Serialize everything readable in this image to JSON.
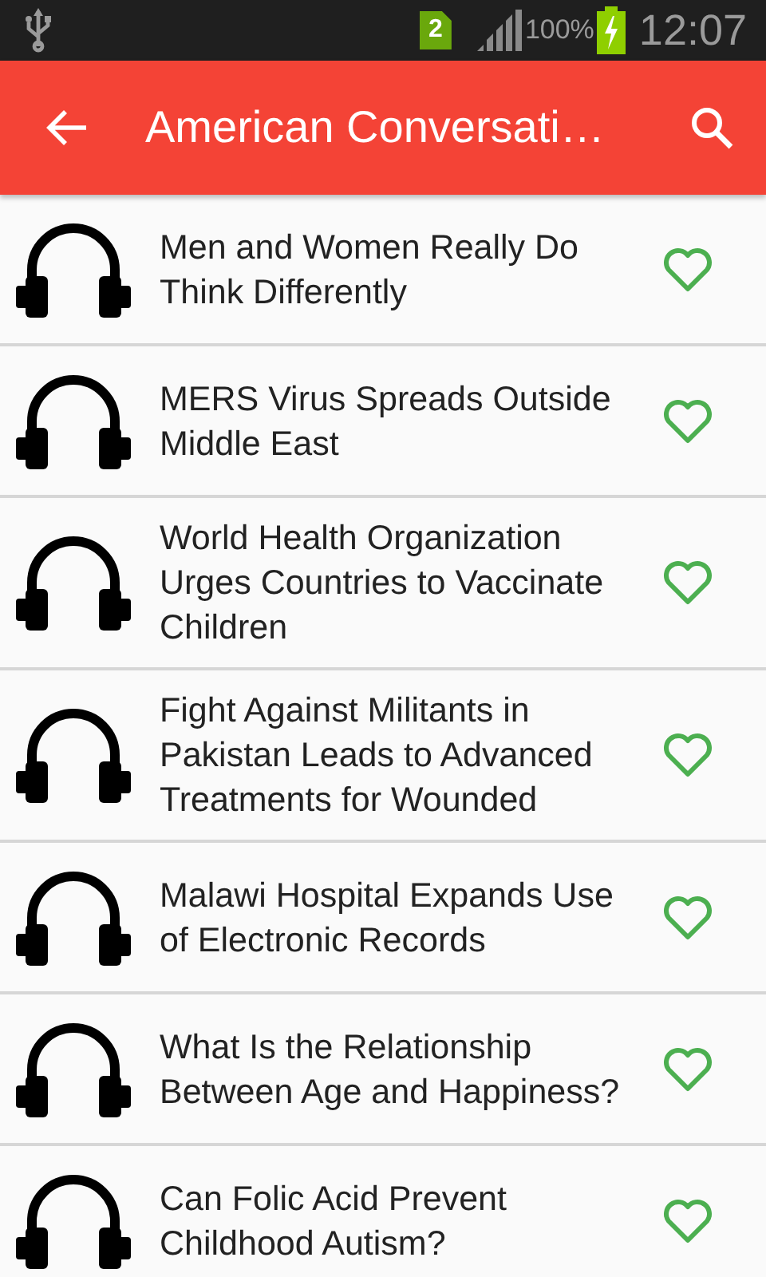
{
  "status_bar": {
    "sim_label": "2",
    "battery": "100%",
    "time": "12:07"
  },
  "app_bar": {
    "title": "American Conversati…"
  },
  "items": [
    {
      "title": "Men and Women Really Do Think Differently",
      "favorite": false
    },
    {
      "title": "MERS Virus Spreads Outside Middle East",
      "favorite": false
    },
    {
      "title": "World Health Organization Urges Countries to Vaccinate Children",
      "favorite": false
    },
    {
      "title": "Fight Against Militants in Pakistan Leads to Advanced Treatments for Wounded",
      "favorite": false
    },
    {
      "title": "Malawi Hospital Expands Use of Electronic Records",
      "favorite": false
    },
    {
      "title": "What Is the Relationship Between Age and Happiness?",
      "favorite": false
    },
    {
      "title": "Can Folic Acid Prevent Childhood Autism?",
      "favorite": false
    }
  ]
}
